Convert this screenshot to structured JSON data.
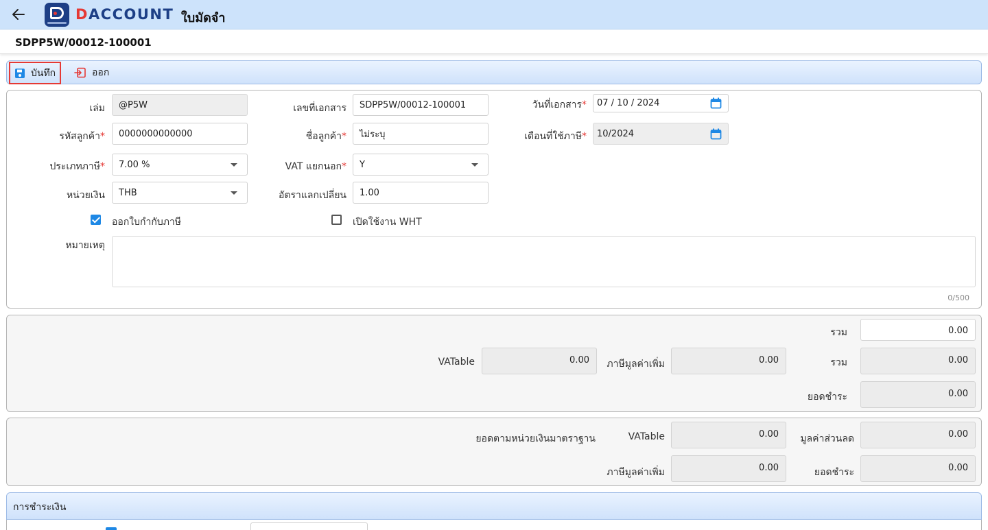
{
  "header": {
    "back_icon": "arrow-left-icon",
    "logo_text_d": "D",
    "logo_text_rest": "ACCOUNT",
    "app_title": "ใบมัดจำ",
    "brand_color": "#1d3f86",
    "accent_color": "#e53935"
  },
  "document": {
    "number": "SDPP5W/00012-100001"
  },
  "toolbar": {
    "save_label": "บันทึก",
    "save_icon": "floppy-disk-icon",
    "exit_label": "ออก",
    "exit_icon": "sign-out-icon"
  },
  "form": {
    "book": {
      "label": "เล่ม",
      "value": "@P5W"
    },
    "doc_no": {
      "label": "เลขที่เอกสาร",
      "value": "SDPP5W/00012-100001"
    },
    "doc_date": {
      "label": "วันที่เอกสาร",
      "required": "*",
      "value": "07 / 10 /  2024"
    },
    "customer_code": {
      "label": "รหัสลูกค้า",
      "required": "*",
      "value": "0000000000000"
    },
    "customer_name": {
      "label": "ชื่อลูกค้า",
      "required": "*",
      "value": "ไม่ระบุ"
    },
    "tax_month": {
      "label": "เดือนที่ใช้ภาษี",
      "required": "*",
      "value": "10/2024"
    },
    "tax_type": {
      "label": "ประเภทภาษี",
      "required": "*",
      "value": "7.00 %"
    },
    "vat_separate": {
      "label": "VAT แยกนอก",
      "required": "*",
      "value": "Y"
    },
    "currency": {
      "label": "หน่วยเงิน",
      "value": "THB"
    },
    "exchange_rate": {
      "label": "อัตราแลกเปลี่ยน",
      "value": "1.00"
    },
    "issue_tax_invoice": {
      "label": "ออกใบกำกับภาษี",
      "checked": true
    },
    "enable_wht": {
      "label": "เปิดใช้งาน WHT",
      "checked": false
    },
    "remark": {
      "label": "หมายเหตุ",
      "value": "",
      "counter": "0/500"
    }
  },
  "totals": {
    "sum_label": "รวม",
    "sum_value": "0.00",
    "vatable_label": "VATable",
    "vatable_value": "0.00",
    "vat_label": "ภาษีมูลค่าเพิ่ม",
    "vat_value": "0.00",
    "sum2_label": "รวม",
    "sum2_value": "0.00",
    "net_label": "ยอดชำระ",
    "net_value": "0.00"
  },
  "base_currency": {
    "title": "ยอดตามหน่วยเงินมาตราฐาน",
    "vatable_label": "VATable",
    "vatable_value": "0.00",
    "discount_label": "มูลค่าส่วนลด",
    "discount_value": "0.00",
    "vat_label": "ภาษีมูลค่าเพิ่ม",
    "vat_value": "0.00",
    "net_label": "ยอดชำระ",
    "net_value": "0.00"
  },
  "payment": {
    "title": "การชำระเงิน"
  }
}
